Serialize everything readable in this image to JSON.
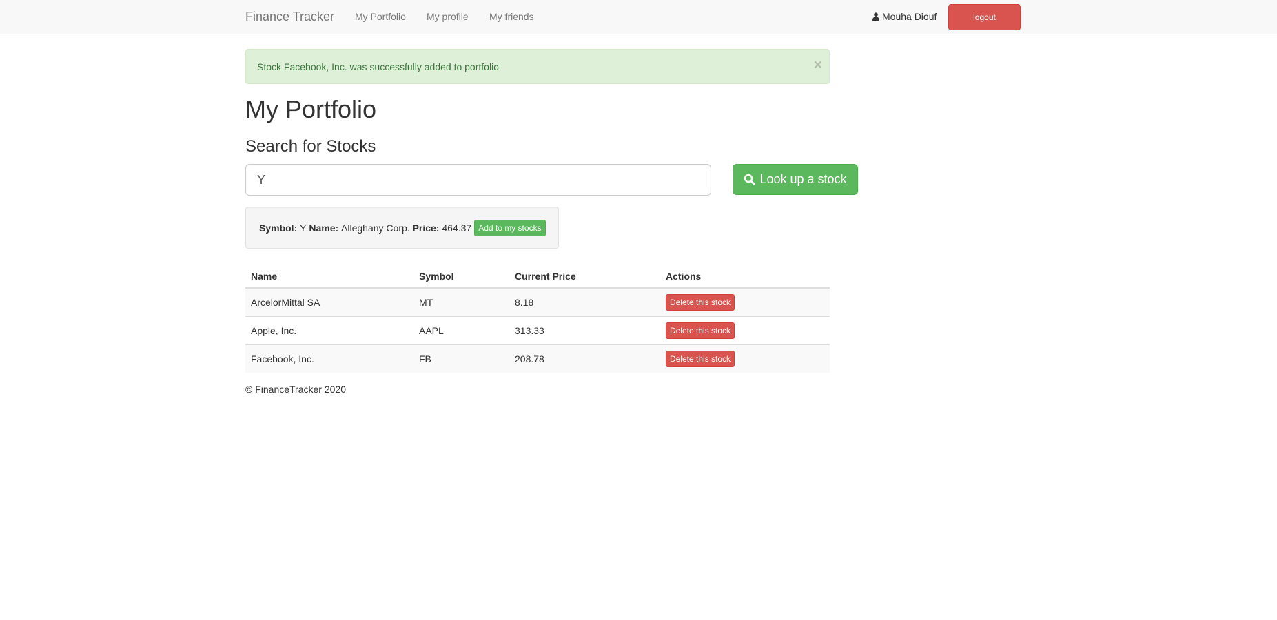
{
  "navbar": {
    "brand": "Finance Tracker",
    "links": [
      "My Portfolio",
      "My profile",
      "My friends"
    ],
    "user_name": "Mouha Diouf",
    "user_icon": "user-icon",
    "logout_label": "logout"
  },
  "alert": {
    "message": "Stock Facebook, Inc. was successfully added to portfolio",
    "close_symbol": "×"
  },
  "page": {
    "title": "My Portfolio",
    "search_heading": "Search for Stocks"
  },
  "search": {
    "value": "Y",
    "button_label": "Look up a stock",
    "button_icon": "search-icon"
  },
  "result": {
    "symbol_label": "Symbol:",
    "symbol": "Y",
    "name_label": "Name:",
    "name": "Alleghany Corp.",
    "price_label": "Price:",
    "price": "464.37",
    "add_label": "Add to my stocks"
  },
  "table": {
    "headers": [
      "Name",
      "Symbol",
      "Current Price",
      "Actions"
    ],
    "rows": [
      {
        "name": "ArcelorMittal SA",
        "symbol": "MT",
        "price": "8.18",
        "action": "Delete this stock"
      },
      {
        "name": "Apple, Inc.",
        "symbol": "AAPL",
        "price": "313.33",
        "action": "Delete this stock"
      },
      {
        "name": "Facebook, Inc.",
        "symbol": "FB",
        "price": "208.78",
        "action": "Delete this stock"
      }
    ]
  },
  "footer": {
    "text": "© FinanceTracker 2020"
  },
  "colors": {
    "success": "#5cb85c",
    "danger": "#d9534f",
    "alert_bg": "#dff0d8",
    "alert_text": "#3c763d"
  }
}
